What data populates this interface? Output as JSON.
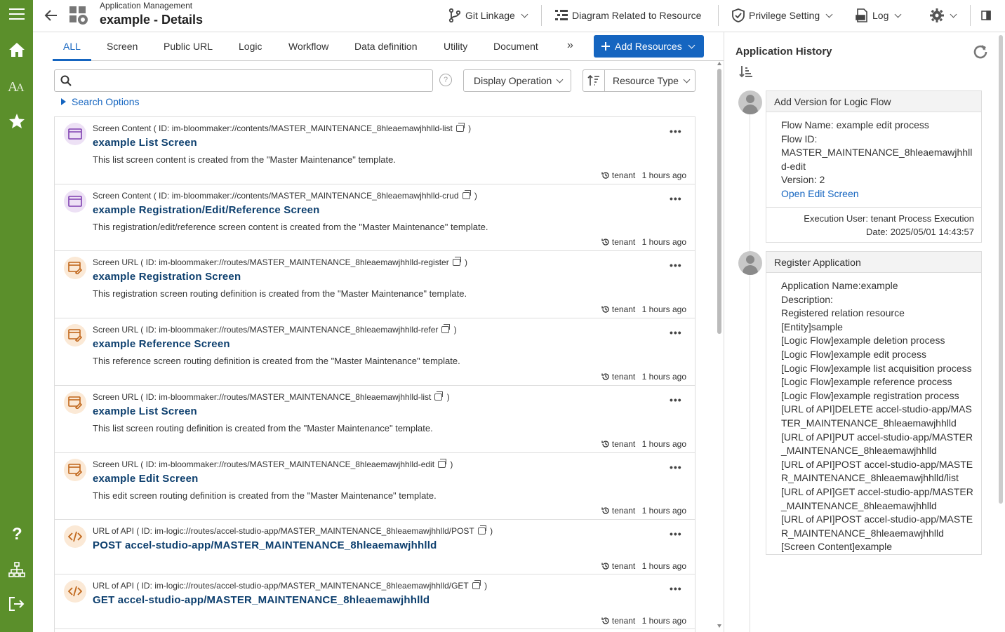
{
  "header": {
    "app_sub": "Application Management",
    "app_title": "example - Details",
    "git": "Git Linkage",
    "diagram": "Diagram Related to Resource",
    "privilege": "Privilege Setting",
    "log": "Log"
  },
  "tabs": [
    "ALL",
    "Screen",
    "Public URL",
    "Logic",
    "Workflow",
    "Data definition",
    "Utility",
    "Document"
  ],
  "add_resources": "Add Resources",
  "search": {
    "placeholder": "",
    "display_operation": "Display Operation",
    "resource_type": "Resource Type",
    "search_options": "Search Options"
  },
  "resources": [
    {
      "kind": "screen",
      "type": "Screen Content ( ID: im-bloommaker://contents/MASTER_MAINTENANCE_8hleaemawjhhlld-list",
      "name": "example List Screen",
      "desc": "This list screen content is created from the \"Master Maintenance\" template.",
      "user": "tenant",
      "time": "1 hours ago"
    },
    {
      "kind": "screen",
      "type": "Screen Content ( ID: im-bloommaker://contents/MASTER_MAINTENANCE_8hleaemawjhhlld-crud",
      "name": "example Registration/Edit/Reference Screen",
      "desc": "This registration/edit/reference screen content is created from the \"Master Maintenance\" template.",
      "user": "tenant",
      "time": "1 hours ago"
    },
    {
      "kind": "route",
      "type": "Screen URL ( ID: im-bloommaker://routes/MASTER_MAINTENANCE_8hleaemawjhhlld-register",
      "name": "example Registration Screen",
      "desc": "This registration screen routing definition is created from the \"Master Maintenance\" template.",
      "user": "tenant",
      "time": "1 hours ago"
    },
    {
      "kind": "route",
      "type": "Screen URL ( ID: im-bloommaker://routes/MASTER_MAINTENANCE_8hleaemawjhhlld-refer",
      "name": "example Reference Screen",
      "desc": "This reference screen routing definition is created from the \"Master Maintenance\" template.",
      "user": "tenant",
      "time": "1 hours ago"
    },
    {
      "kind": "route",
      "type": "Screen URL ( ID: im-bloommaker://routes/MASTER_MAINTENANCE_8hleaemawjhhlld-list",
      "name": "example List Screen",
      "desc": "This list screen routing definition is created from the \"Master Maintenance\" template.",
      "user": "tenant",
      "time": "1 hours ago"
    },
    {
      "kind": "route",
      "type": "Screen URL ( ID: im-bloommaker://routes/MASTER_MAINTENANCE_8hleaemawjhhlld-edit",
      "name": "example Edit Screen",
      "desc": "This edit screen routing definition is created from the \"Master Maintenance\" template.",
      "user": "tenant",
      "time": "1 hours ago"
    },
    {
      "kind": "api",
      "type": "URL of API ( ID: im-logic://routes/accel-studio-app/MASTER_MAINTENANCE_8hleaemawjhhlld/POST",
      "name": "POST accel-studio-app/MASTER_MAINTENANCE_8hleaemawjhhlld",
      "desc": "",
      "user": "tenant",
      "time": "1 hours ago"
    },
    {
      "kind": "api",
      "type": "URL of API ( ID: im-logic://routes/accel-studio-app/MASTER_MAINTENANCE_8hleaemawjhhlld/GET",
      "name": "GET accel-studio-app/MASTER_MAINTENANCE_8hleaemawjhhlld",
      "desc": "",
      "user": "tenant",
      "time": "1 hours ago"
    }
  ],
  "history": {
    "title": "Application History",
    "items": [
      {
        "title": "Add Version for Logic Flow",
        "lines": [
          "Flow Name: example edit process",
          "Flow ID:",
          "MASTER_MAINTENANCE_8hleaemawjhhlld-edit",
          "Version: 2"
        ],
        "link": "Open Edit Screen",
        "exec": "Execution User: tenant   Process Execution Date: 2025/05/01 14:43:57"
      },
      {
        "title": "Register Application",
        "lines": [
          "Application Name:example",
          "Description:",
          "Registered relation resource",
          "[Entity]sample",
          "[Logic Flow]example deletion process",
          "[Logic Flow]example edit process",
          "[Logic Flow]example list acquisition process",
          "[Logic Flow]example reference process",
          "[Logic Flow]example registration process",
          "[URL of API]DELETE accel-studio-app/MASTER_MAINTENANCE_8hleaemawjhhlld",
          "[URL of API]PUT accel-studio-app/MASTER_MAINTENANCE_8hleaemawjhhlld",
          "[URL of API]POST accel-studio-app/MASTER_MAINTENANCE_8hleaemawjhhlld/list",
          "[URL of API]GET accel-studio-app/MASTER_MAINTENANCE_8hleaemawjhhlld",
          "[URL of API]POST accel-studio-app/MASTER_MAINTENANCE_8hleaemawjhhlld",
          "[Screen Content]example"
        ],
        "link": "",
        "exec": ""
      }
    ]
  },
  "colors": {
    "rail": "#5b8f2b",
    "accent": "#1565c0",
    "title_link": "#0d3f6e"
  },
  "icons": [
    "menu-icon",
    "home-icon",
    "font-icon",
    "star-icon",
    "help-icon",
    "sitemap-icon",
    "logout-icon",
    "back-arrow-icon",
    "app-gear-icon",
    "git-icon",
    "diagram-icon",
    "shield-icon",
    "log-icon",
    "gear-icon",
    "panel-toggle-icon",
    "search-icon",
    "sort-icon",
    "copy-icon",
    "history-icon",
    "refresh-icon"
  ]
}
